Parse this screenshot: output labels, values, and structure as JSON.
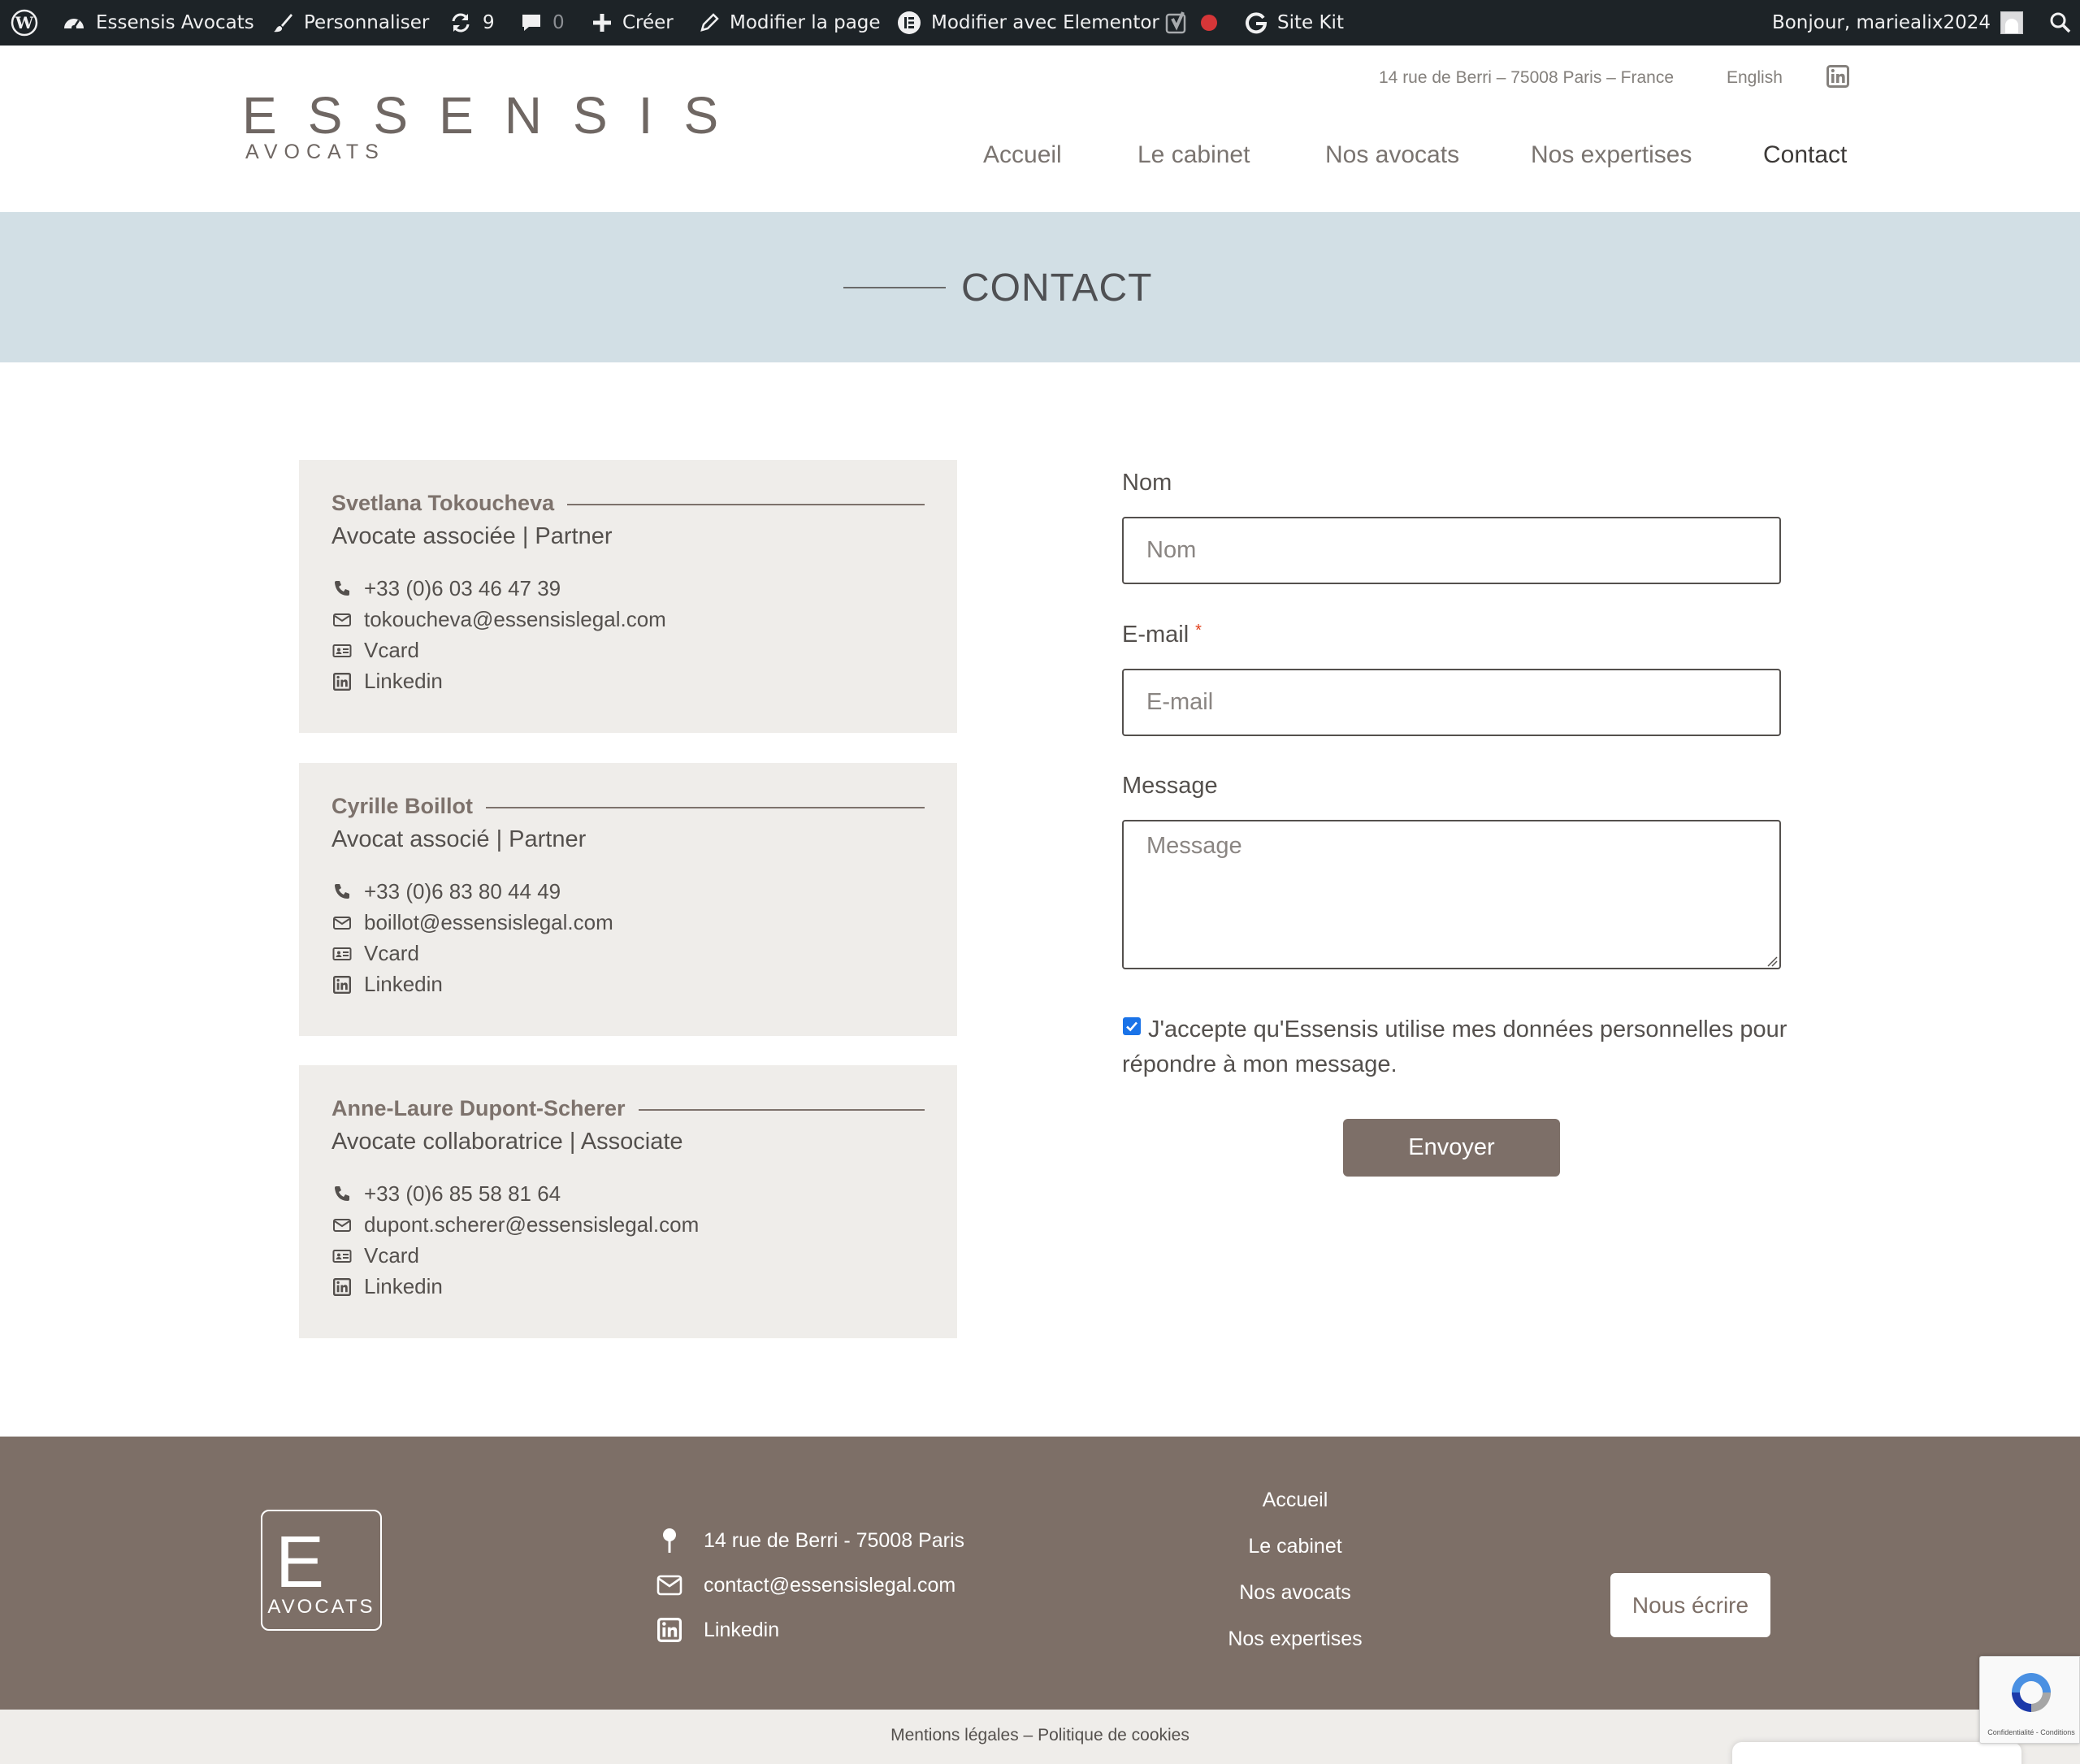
{
  "admin_bar": {
    "site_name": "Essensis Avocats",
    "customize": "Personnaliser",
    "updates_count": "9",
    "comments_count": "0",
    "new": "Créer",
    "edit_page": "Modifier la page",
    "edit_elementor": "Modifier avec Elementor",
    "site_kit": "Site Kit",
    "greeting": "Bonjour, marie­alix2024"
  },
  "header": {
    "logo_word": "ESSENSIS",
    "logo_sub": "AVOCATS",
    "address": "14 rue de Berri – 75008 Paris – France",
    "language": "English",
    "nav": [
      "Accueil",
      "Le cabinet",
      "Nos avocats",
      "Nos expertises",
      "Contact"
    ]
  },
  "banner": {
    "title": "CONTACT"
  },
  "lawyers": [
    {
      "name": "Svetlana Tokoucheva",
      "role": "Avocate associée | Partner",
      "phone": "+33 (0)6 03 46 47 39",
      "email": "tokoucheva@essensislegal.com",
      "vcard": "Vcard",
      "linkedin": "Linkedin"
    },
    {
      "name": "Cyrille Boillot",
      "role": "Avocat associé | Partner",
      "phone": "+33 (0)6 83 80 44 49",
      "email": "boillot@essensislegal.com",
      "vcard": "Vcard",
      "linkedin": "Linkedin"
    },
    {
      "name": "Anne-Laure Dupont-Scherer",
      "role": "Avocate collaboratrice | Associate",
      "phone": "+33 (0)6 85 58 81 64",
      "email": "dupont.scherer@essensislegal.com",
      "vcard": "Vcard",
      "linkedin": "Linkedin"
    }
  ],
  "form": {
    "name_label": "Nom",
    "name_placeholder": "Nom",
    "email_label": "E-mail",
    "email_required_mark": "*",
    "email_placeholder": "E-mail",
    "message_label": "Message",
    "message_placeholder": "Message",
    "consent_checked": true,
    "consent_text": "J'accepte qu'Essensis utilise mes données personnelles pour répondre à mon message.",
    "submit": "Envoyer"
  },
  "footer": {
    "logo_letter": "E",
    "logo_sub": "AVOCATS",
    "address": "14 rue de Berri - 75008 Paris",
    "email": "contact@essensislegal.com",
    "linkedin": "Linkedin",
    "nav": [
      "Accueil",
      "Le cabinet",
      "Nos avocats",
      "Nos expertises"
    ],
    "write_button": "Nous écrire"
  },
  "bottom": {
    "links": "Mentions légales – Politique de cookies"
  },
  "recaptcha": {
    "terms": "Confidentialité - Conditions"
  },
  "colors": {
    "admin_bar": "#1d2327",
    "banner": "#d2dfe5",
    "card": "#efedea",
    "accent_brown": "#7d6f68",
    "checkbox": "#1a73e8"
  }
}
